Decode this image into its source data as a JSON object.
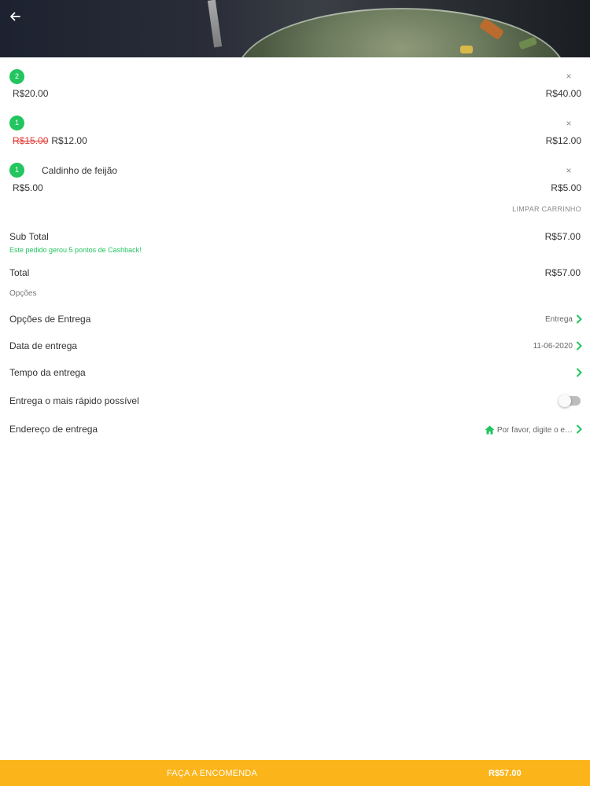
{
  "cart": {
    "items": [
      {
        "qty": "2",
        "name": "",
        "old_price": "",
        "unit_price": "R$20.00",
        "line_total": "R$40.00",
        "remove": "×"
      },
      {
        "qty": "1",
        "name": "",
        "old_price": "R$15.00",
        "unit_price": "R$12.00",
        "line_total": "R$12.00",
        "remove": "×"
      },
      {
        "qty": "1",
        "name": "Caldinho de feijão",
        "old_price": "",
        "unit_price": "R$5.00",
        "line_total": "R$5.00",
        "remove": "×"
      }
    ],
    "clear_label": "LIMPAR CARRINHO"
  },
  "summary": {
    "subtotal_label": "Sub Total",
    "subtotal_value": "R$57.00",
    "cashback_msg": "Este pedido gerou 5 pontos de Cashback!",
    "total_label": "Total",
    "total_value": "R$57.00"
  },
  "options": {
    "section_label": "Opções",
    "delivery_option_label": "Opções de Entrega",
    "delivery_option_value": "Entrega",
    "delivery_date_label": "Data de entrega",
    "delivery_date_value": "11-06-2020",
    "delivery_time_label": "Tempo da entrega",
    "delivery_time_value": "",
    "asap_label": "Entrega o mais rápido possível",
    "asap_enabled": false,
    "address_label": "Endereço de entrega",
    "address_value": "Por favor, digite o e…"
  },
  "footer": {
    "order_label": "FAÇA A ENCOMENDA",
    "total": "R$57.00"
  },
  "colors": {
    "accent_green": "#22c55e",
    "footer_yellow": "#fbb419",
    "strike_red": "#e53935"
  },
  "icons": {
    "back": "arrow-left-icon",
    "remove": "close-icon",
    "chevron": "chevron-right-icon",
    "address": "home-icon"
  }
}
